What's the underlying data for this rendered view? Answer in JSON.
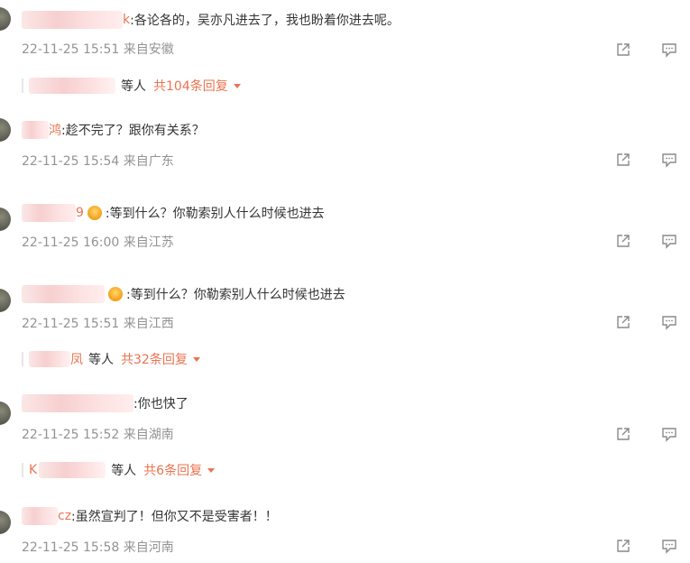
{
  "comments": [
    {
      "name_tail": "k",
      "text": ":各论各的，吴亦凡进去了，我也盼着你进去呢。",
      "meta": "22-11-25 15:51 来自安徽",
      "reply": {
        "deng": "等人",
        "count": "共104条回复"
      }
    },
    {
      "name_tail": "鸿",
      "text": ":趁不完了？跟你有关系？",
      "meta": "22-11-25 15:54 来自广东"
    },
    {
      "name_tail": "9",
      "text": ":等到什么？你勒索别人什么时候也进去",
      "meta": "22-11-25 16:00 来自江苏"
    },
    {
      "name_tail": "",
      "text": ":等到什么？你勒索别人什么时候也进去",
      "meta": "22-11-25 15:51 来自江西",
      "reply": {
        "deng": "等人",
        "count": "共32条回复",
        "name_tail": "凤"
      }
    },
    {
      "name_tail": "",
      "text": ":你也快了",
      "meta": "22-11-25 15:52 来自湖南",
      "reply": {
        "deng": "等人",
        "count": "共6条回复",
        "name_tail": "K"
      }
    },
    {
      "name_tail": "cz",
      "text": ":虽然宣判了！但你又不是受害者！！",
      "meta": "22-11-25 15:58 来自河南"
    }
  ],
  "icons": {
    "share": "share-icon",
    "comment": "comment-icon",
    "badge": "vip-badge-icon"
  },
  "colors": {
    "accent": "#eb7350",
    "meta": "#939393",
    "text": "#333333"
  }
}
